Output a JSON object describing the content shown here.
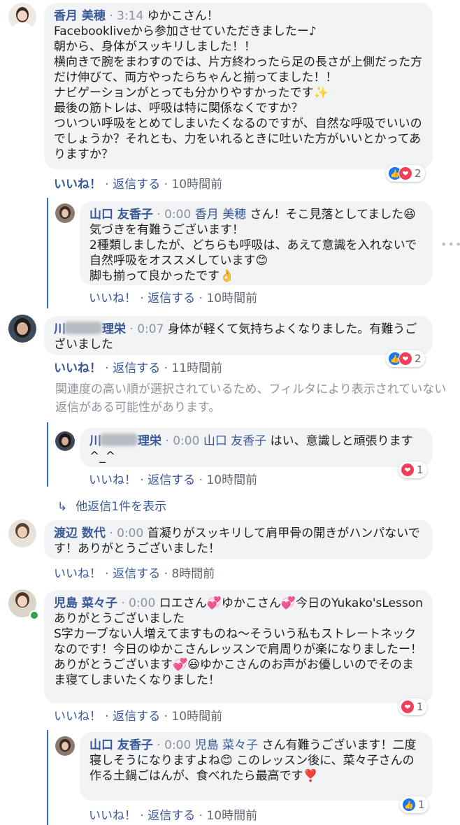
{
  "comments": [
    {
      "author": "香月 美穂",
      "time": "3:14",
      "text": "ゆかこさん！\nFacebookliveから参加させていただきましたー♪\n朝から、身体がスッキリしました！！\n横向きで腕をまわすのでは、片方終わったら足の長さが上側だった方だけ伸びて、両方やったらちゃんと揃ってました！！\nナビゲーションがとっても分かりやすかったです✨\n最後の筋トレは、呼吸は特に関係なくですか？\nついつい呼吸をとめてしまいたくなるのですが、自然な呼吸でいいのでしょうか？それとも、力をいれるときに吐いた方がいいとかってありますか？",
      "like": "いいね！",
      "reply": "返信する",
      "age": "10時間前",
      "reaction_count": "2"
    },
    {
      "author": "山口 友香子",
      "time": "0:00",
      "mention": "香月 美穂",
      "text": " さん！そこ見落としてました😆気づきを有難うございます！\n2種類しましたが、どちらも呼吸は、あえて意識を入れないで自然呼吸をオススメしています😊\n脚も揃って良かったです👌",
      "like": "いいね！",
      "reply": "返信する",
      "age": "10時間前"
    },
    {
      "author": "川",
      "author_tail": "理栄",
      "time": "0:07",
      "text": "身体が軽くて気持ちよくなりました。有難うございました",
      "like": "いいね！",
      "reply": "返信する",
      "age": "11時間前",
      "reaction_count": "2"
    },
    {
      "author": "川",
      "author_tail": "理栄",
      "time": "0:00",
      "mention": "山口 友香子",
      "text": " はい、意識しと頑張ります^_^",
      "like": "いいね！",
      "reply": "返信する",
      "age": "10時間前",
      "reaction_count": "1"
    },
    {
      "author": "渡辺 数代",
      "time": "0:00",
      "text": "首凝りがスッキリして肩甲骨の開きがハンパないです！ありがとうございました！",
      "like": "いいね！",
      "reply": "返信する",
      "age": "8時間前"
    },
    {
      "author": "児島 菜々子",
      "time": "0:00",
      "text": "ロエさん💞ゆかこさん💞今日のYukako'sLessonありがとうございました\nS字カーブない人増えてますものね〜そういう私もストレートネックなのです！今日のゆかこさんレッスンで肩周りが楽になりましたー！\nありがとうございます💞😃ゆかこさんのお声がお優しいのでそのまま寝てしまいたくなりました！",
      "like": "いいね！",
      "reply": "返信する",
      "age": "10時間前",
      "reaction_count": "1"
    },
    {
      "author": "山口 友香子",
      "time": "0:00",
      "mention": "児島 菜々子",
      "text": " さん有難うございます！二度寝しそうになりますよね😊 このレッスン後に、菜々子さんの作る土鍋ごはんが、食べれたら最高です❣️",
      "like": "いいね！",
      "reply": "返信する",
      "age": "10時間前",
      "reaction_count": "1"
    }
  ],
  "filter_notice": "関連度の高い順が選択されているため、フィルタにより表示されていない返信がある可能性があります。",
  "more_replies": "他返信1件を表示",
  "separator": "·",
  "icons": {
    "like": "thumbs-up-icon",
    "love": "heart-icon",
    "more": "more-options-icon",
    "reply_arrow": "reply-arrow-icon"
  },
  "colors": {
    "link": "#385898",
    "bubble": "#f2f3f5",
    "thread_line": "#2d6cdf",
    "like": "#1877f2",
    "love": "#f33e58"
  }
}
